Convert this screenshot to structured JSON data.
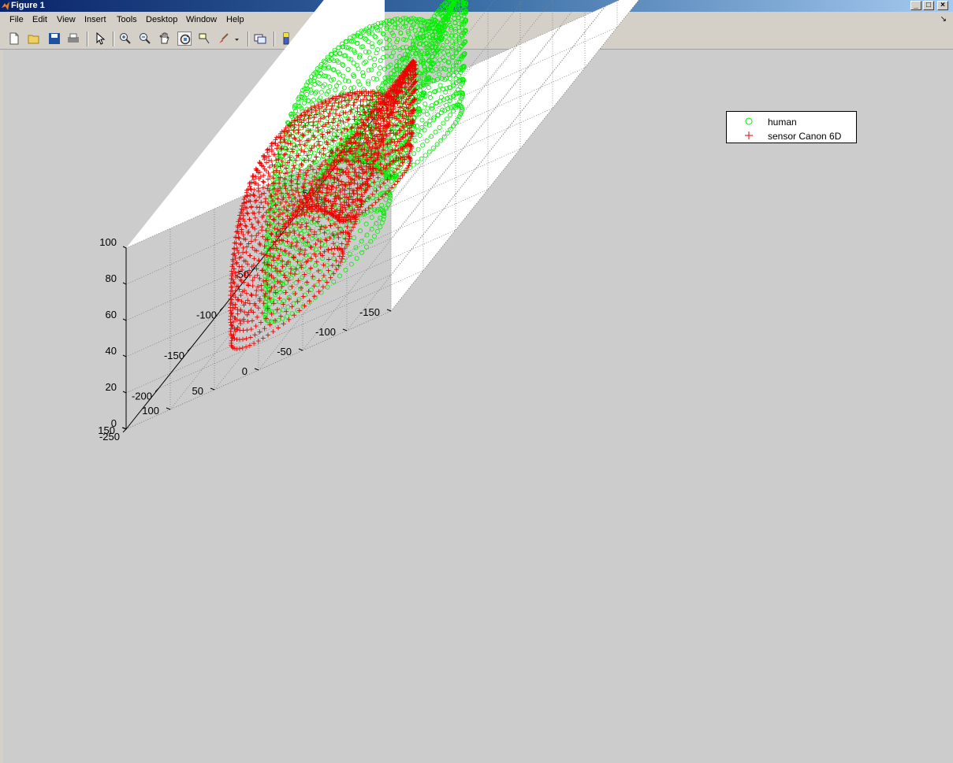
{
  "window": {
    "title": "Figure 1"
  },
  "menu": {
    "items": [
      "File",
      "Edit",
      "View",
      "Insert",
      "Tools",
      "Desktop",
      "Window",
      "Help"
    ]
  },
  "toolbar": {
    "buttons": [
      "new-figure-icon",
      "open-file-icon",
      "save-icon",
      "print-icon",
      "pointer-icon",
      "zoom-in-icon",
      "zoom-out-icon",
      "pan-icon",
      "rotate-3d-icon",
      "data-cursor-icon",
      "brush-icon",
      "link-plot-icon",
      "colorbar-icon",
      "legend-icon",
      "hide-plot-tools-icon",
      "show-plot-tools-icon"
    ],
    "active": [
      "rotate-3d-icon",
      "legend-icon"
    ]
  },
  "legend": {
    "entries": [
      {
        "label": "human",
        "marker": "o",
        "color": "#00ee00"
      },
      {
        "label": "sensor Canon 6D",
        "marker": "+",
        "color": "#ee0000"
      }
    ]
  },
  "chart_data": {
    "type": "scatter",
    "projection": "3d",
    "grid": true,
    "legend_position": "top-right",
    "x_ticks": [
      "-250",
      "-200",
      "-150",
      "-100",
      "-50",
      "0",
      "50",
      "100",
      "150"
    ],
    "y_ticks": [
      "-150",
      "-100",
      "-50",
      "0",
      "50",
      "100",
      "150"
    ],
    "z_ticks": [
      "0",
      "20",
      "40",
      "60",
      "80",
      "100"
    ],
    "xlim": [
      -250,
      150
    ],
    "ylim": [
      -150,
      150
    ],
    "zlim": [
      0,
      100
    ],
    "series": [
      {
        "name": "human",
        "marker": "o",
        "color": "#00ee00",
        "shape": "closed 3D shell (nested ring surfaces)",
        "approx_extent": {
          "x": [
            -200,
            140
          ],
          "y": [
            -60,
            120
          ],
          "z": [
            0,
            100
          ]
        }
      },
      {
        "name": "sensor Canon 6D",
        "marker": "+",
        "color": "#ee0000",
        "shape": "closed 3D shell (nested ring surfaces)",
        "approx_extent": {
          "x": [
            -220,
            80
          ],
          "y": [
            -40,
            140
          ],
          "z": [
            0,
            80
          ]
        }
      }
    ]
  }
}
